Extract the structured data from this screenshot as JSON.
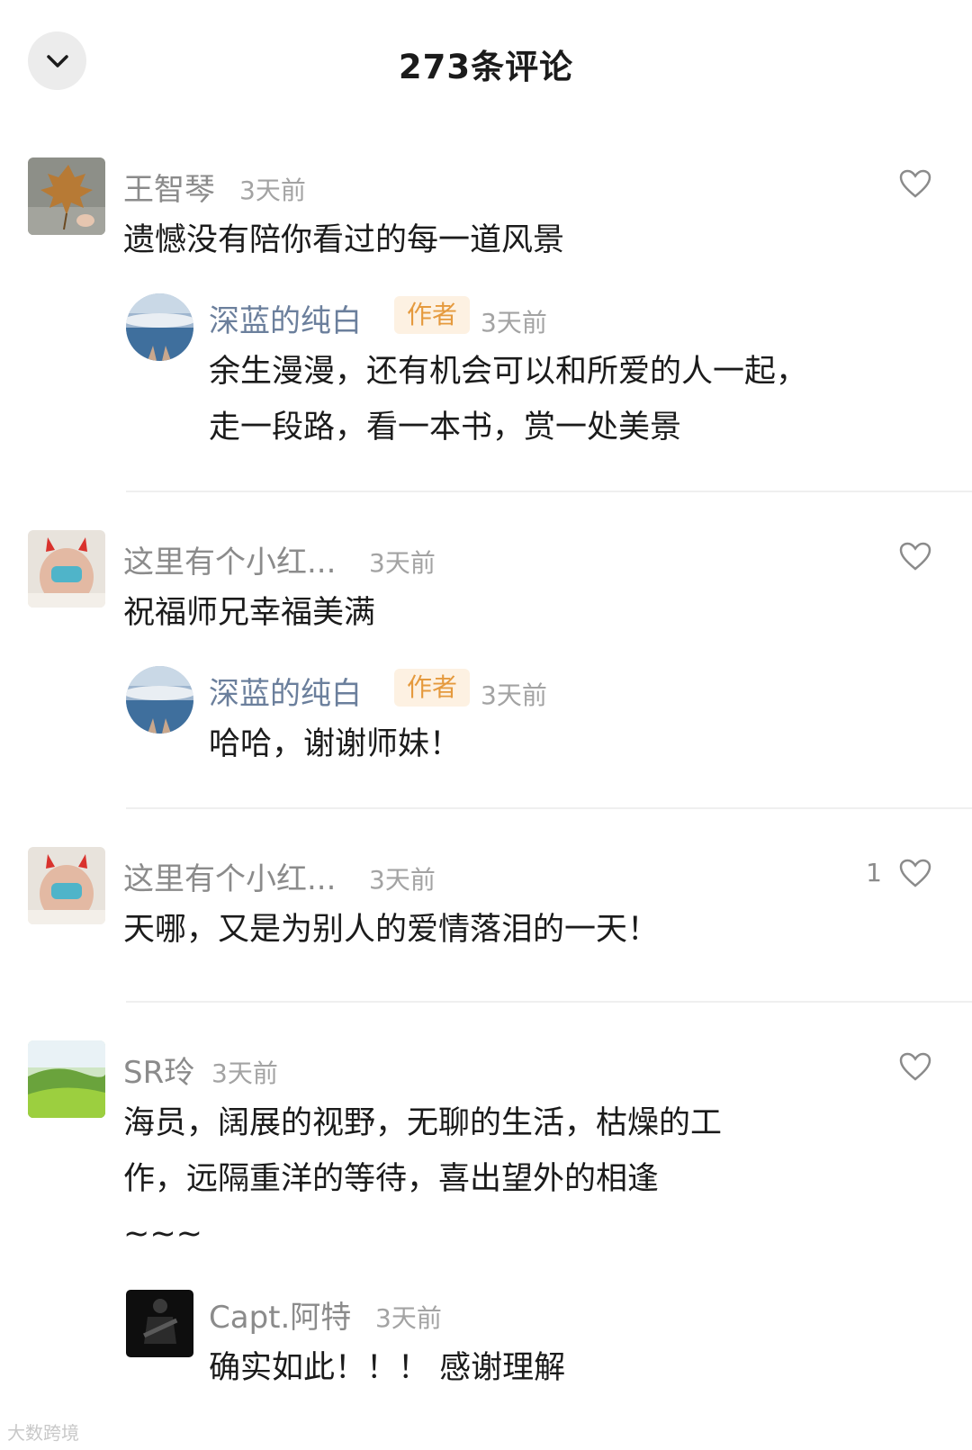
{
  "header": {
    "title": "273条评论",
    "collapse_icon": "chevron-down-icon"
  },
  "comments": [
    {
      "user": "王智琴",
      "time": "3天前",
      "text": [
        "遗憾没有陪你看过的每一道风景"
      ],
      "likes": "",
      "reply": {
        "user": "深蓝的纯白",
        "badge": "作者",
        "time": "3天前",
        "text": [
          "余生漫漫，还有机会可以和所爱的人一起，",
          "走一段路，看一本书，赏一处美景"
        ]
      }
    },
    {
      "user": "这里有个小红...",
      "time": "3天前",
      "text": [
        "祝福师兄幸福美满"
      ],
      "likes": "",
      "reply": {
        "user": "深蓝的纯白",
        "badge": "作者",
        "time": "3天前",
        "text": [
          "哈哈，谢谢师妹！"
        ]
      }
    },
    {
      "user": "这里有个小红...",
      "time": "3天前",
      "text": [
        "天哪，又是为别人的爱情落泪的一天！"
      ],
      "likes": "1"
    },
    {
      "user": "SR玲",
      "time": "3天前",
      "text": [
        "海员，阔展的视野，无聊的生活，枯燥的工",
        "作，远隔重洋的等待，喜出望外的相逢",
        "~~~"
      ],
      "likes": "",
      "reply": {
        "user": "Capt.阿特",
        "badge": "",
        "time": "3天前",
        "text": [
          "确实如此！！！ 感谢理解"
        ]
      }
    }
  ],
  "watermark": "大数跨境",
  "colors": {
    "author_name": "#6b7f9c",
    "badge_bg": "#fdf1e2",
    "badge_text": "#e59a3e",
    "meta": "#a3a3a3"
  }
}
